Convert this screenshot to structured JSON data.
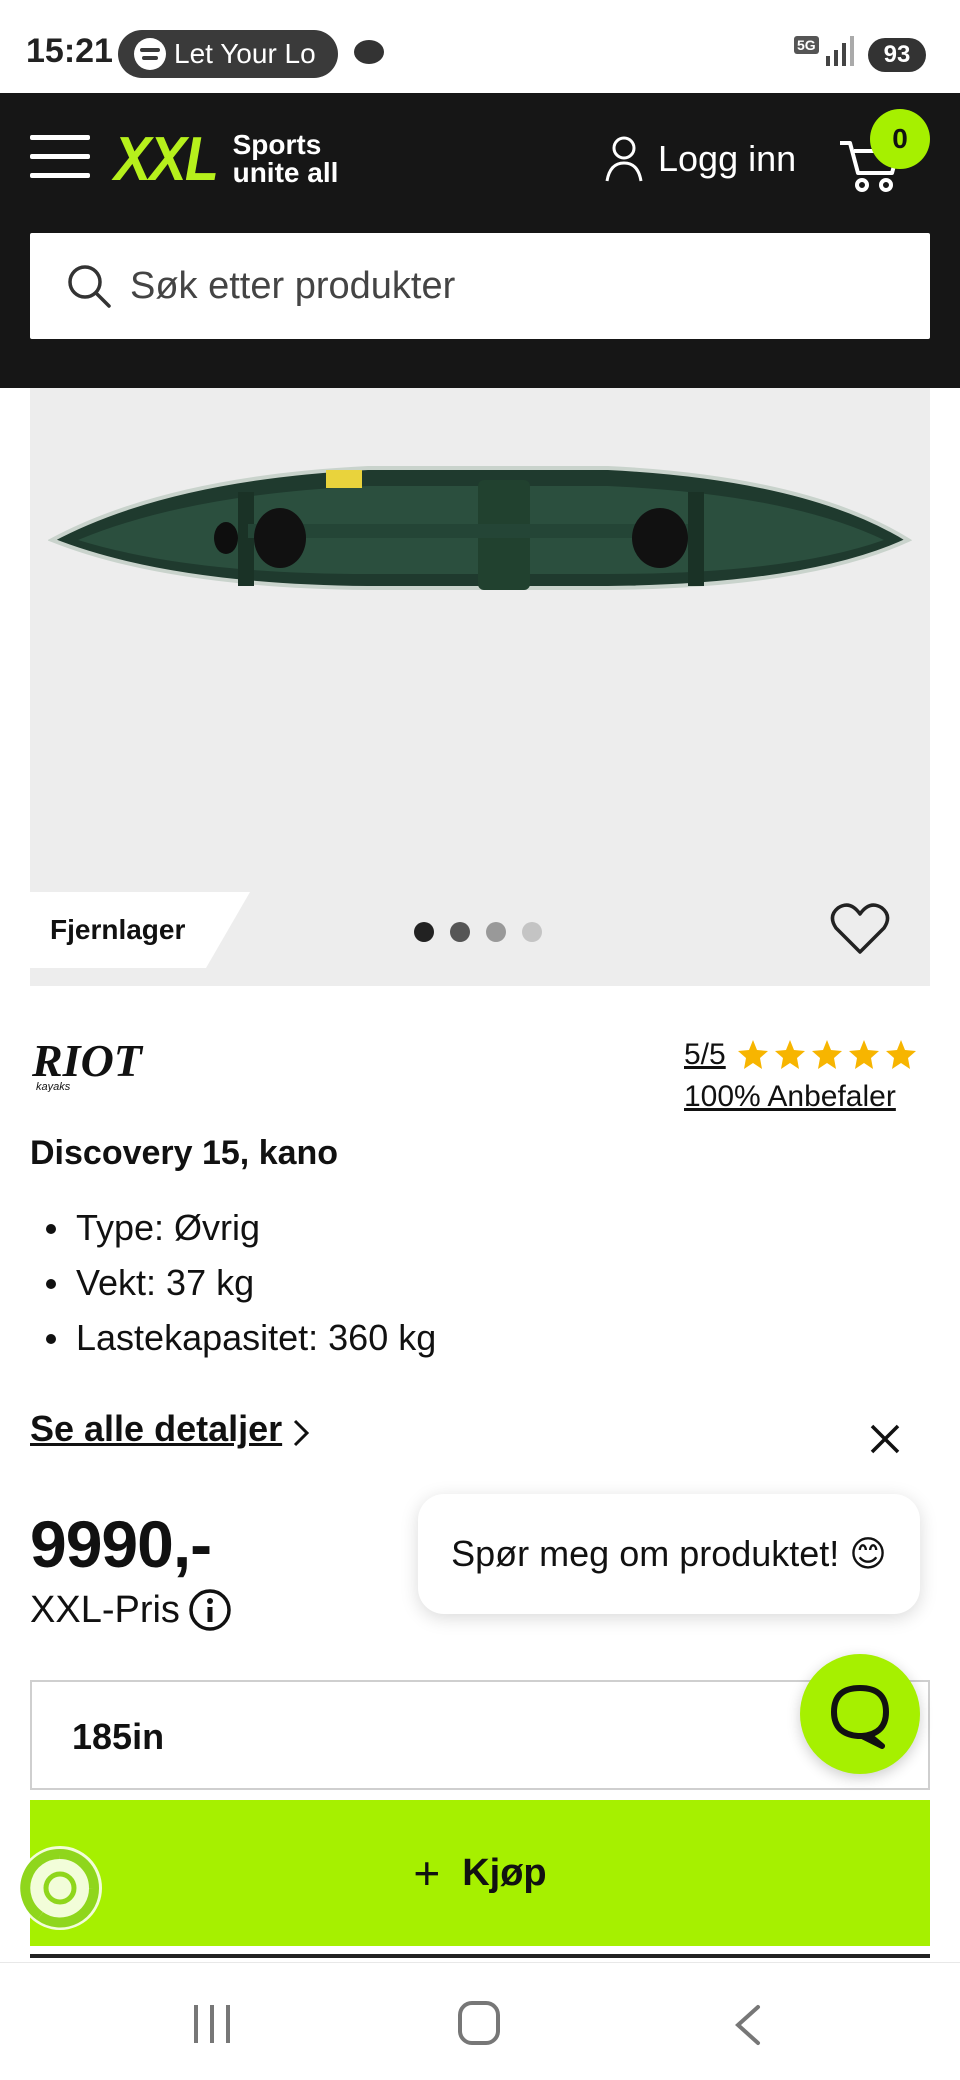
{
  "status_bar": {
    "time": "15:21",
    "media_pill_text": "Let Your Lo",
    "network": "5G",
    "battery": "93"
  },
  "header": {
    "logo_text": "XXL",
    "logo_tagline_1": "Sports",
    "logo_tagline_2": "unite all",
    "login_label": "Logg inn",
    "cart_count": "0",
    "search_placeholder": "Søk etter produkter",
    "accent_color": "#a6f000"
  },
  "gallery": {
    "badge": "Fjernlager",
    "dot_count": 4,
    "active_dot": 0
  },
  "product": {
    "brand_main": "RIOT",
    "brand_sub": "kayaks",
    "rating_score": "5/5",
    "rating_stars": 5,
    "recommend_text": "100% Anbefaler",
    "title": "Discovery 15, kano",
    "specs": [
      "Type: Øvrig",
      "Vekt: 37 kg",
      "Lastekapasitet: 360 kg"
    ],
    "details_link": "Se alle detaljer",
    "price": "9990,-",
    "price_label": "XXL-Pris",
    "size_value": "185in",
    "buy_label": "Kjøp"
  },
  "chat": {
    "bubble_text": "Spør meg om produktet! 😊"
  }
}
